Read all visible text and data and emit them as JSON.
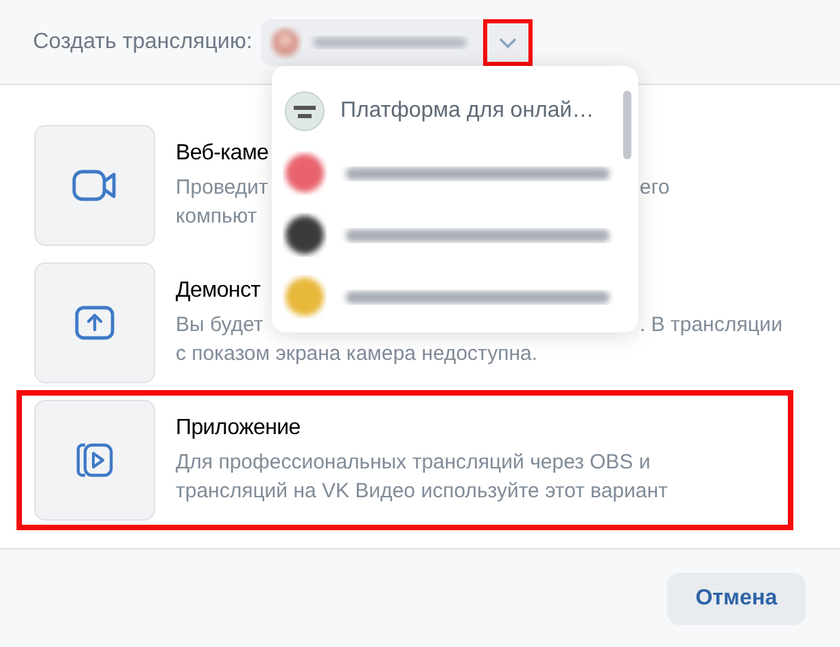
{
  "header": {
    "label": "Создать трансляцию:",
    "owner": {
      "kind": "blurred"
    },
    "chevron": {
      "highlighted": true
    }
  },
  "options": [
    {
      "title": "Веб-каме",
      "kind": "camera",
      "highlighted": false,
      "lines": [
        {
          "left": "Проведит",
          "right": "его"
        },
        {
          "left": "компьют"
        }
      ]
    },
    {
      "title": "Демонст",
      "kind": "upload",
      "highlighted": false,
      "lines": [
        {
          "left": "Вы будет",
          "right": ". В трансляции"
        },
        {
          "left": "с показом экрана камера недоступна."
        }
      ]
    },
    {
      "title": "Приложение",
      "kind": "play",
      "highlighted": true,
      "lines": [
        {
          "left": "Для профессиональных трансляций через OBS и"
        },
        {
          "left": "трансляций на VK Видео используйте этот вариант"
        }
      ]
    }
  ],
  "dropdown": {
    "items": [
      {
        "kind": "text",
        "label": "Платформа для онлай…"
      },
      {
        "kind": "blurred"
      },
      {
        "kind": "blurred"
      },
      {
        "kind": "blurred"
      }
    ]
  },
  "footer": {
    "cancel": "Отмена"
  }
}
